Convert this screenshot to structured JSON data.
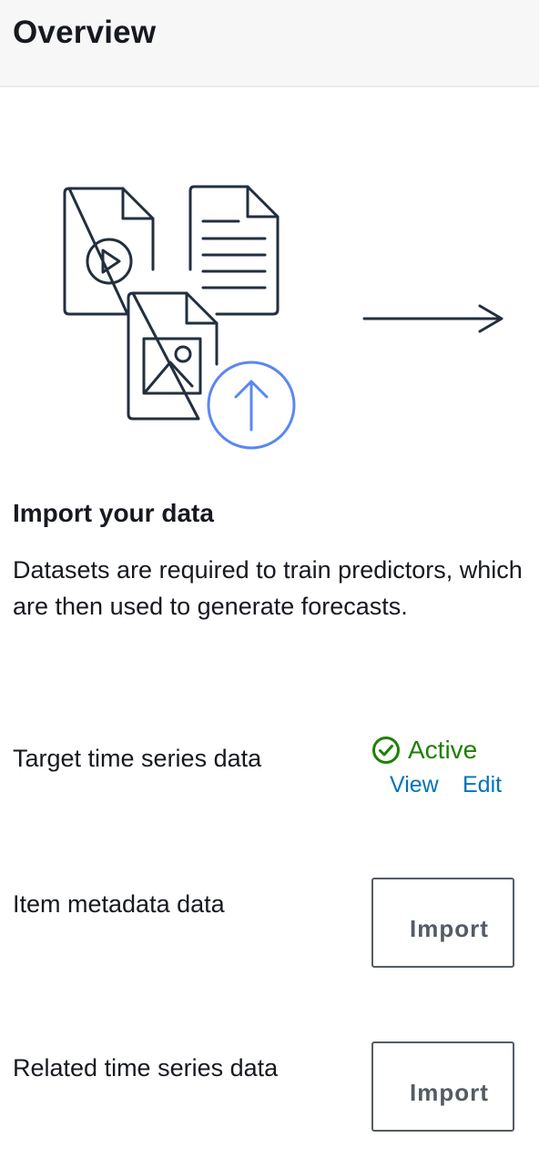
{
  "header": {
    "title": "Overview"
  },
  "illustration": {
    "icons": [
      "video-file-icon",
      "text-document-icon",
      "image-file-icon",
      "upload-icon",
      "arrow-right-icon"
    ],
    "colors": {
      "stroke": "#232f3e",
      "accent": "#5a87f2"
    }
  },
  "import_section": {
    "title": "Import your data",
    "description": "Datasets are required to train predictors, which are then used to generate forecasts."
  },
  "datasets": {
    "target": {
      "label": "Target time series data",
      "status": "Active",
      "status_color": "#1d8102",
      "view_label": "View",
      "edit_label": "Edit"
    },
    "item_metadata": {
      "label": "Item metadata data",
      "button_label": "Import"
    },
    "related": {
      "label": "Related time series data",
      "button_label": "Import"
    }
  }
}
